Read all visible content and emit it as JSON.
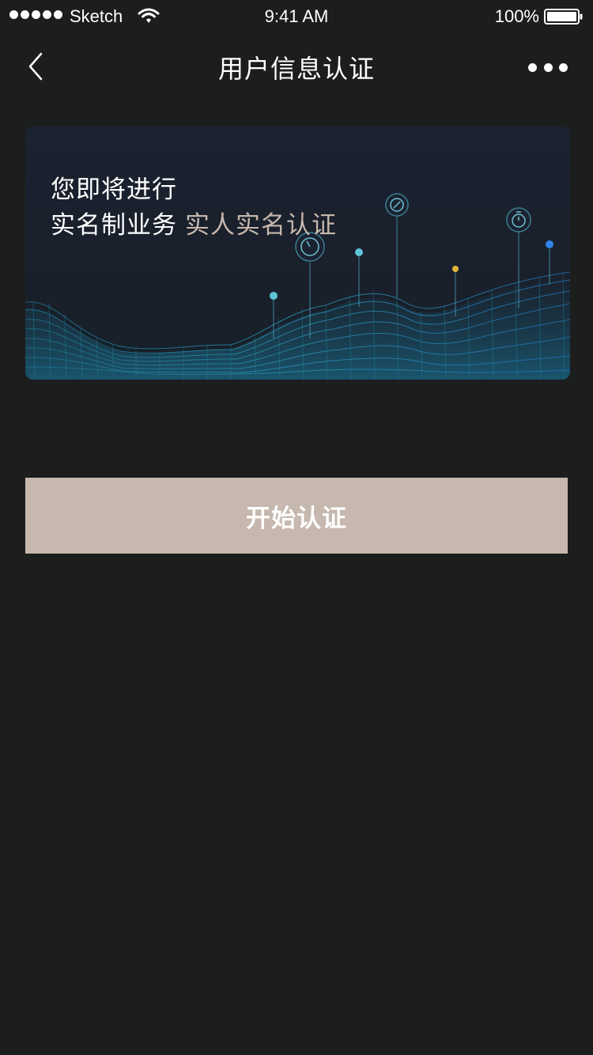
{
  "status_bar": {
    "carrier": "Sketch",
    "time": "9:41 AM",
    "battery": "100%",
    "signal_icon": "signal-dots-icon",
    "wifi_icon": "wifi-icon",
    "battery_icon": "battery-full-icon"
  },
  "nav": {
    "title": "用户信息认证",
    "back_icon": "chevron-left-icon",
    "more_icon": "more-dots-icon"
  },
  "banner": {
    "line1": "您即将进行",
    "line2_prefix": "实名制业务",
    "line2_accent": "实人实名认证",
    "accent_color": "#c7b8ad"
  },
  "action": {
    "start_label": "开始认证",
    "button_color": "#c6b8ae"
  }
}
